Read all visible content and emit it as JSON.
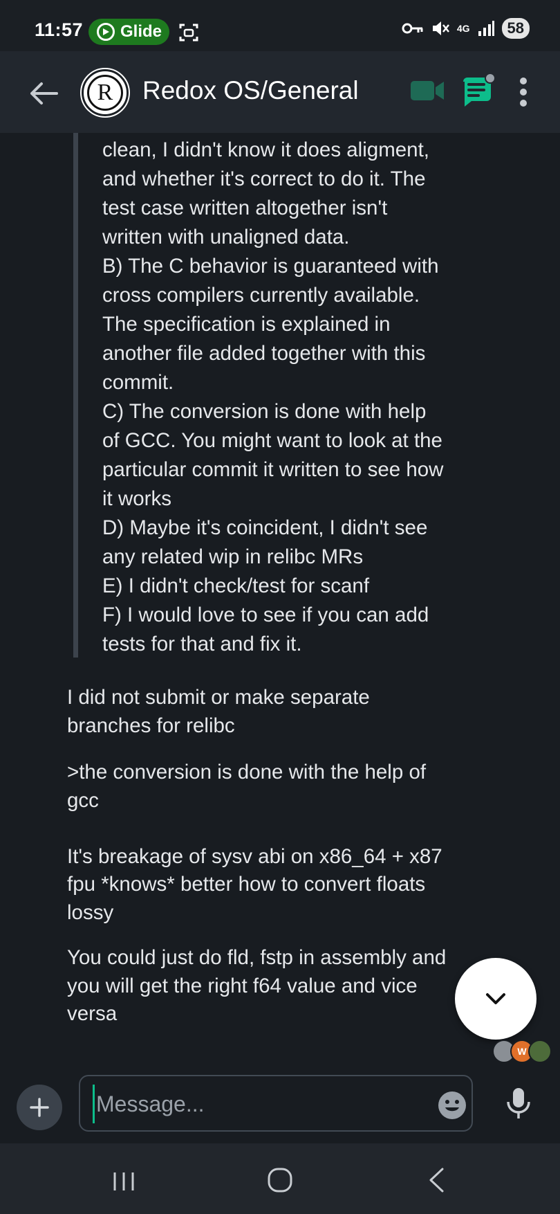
{
  "status_bar": {
    "time": "11:57",
    "app_pill": "Glide",
    "network": "4G",
    "battery": "58"
  },
  "header": {
    "avatar_letter": "R",
    "title": "Redox OS/General"
  },
  "quoted_message": "clean, I didn't know it does aligment,\nand whether it's correct to do it. The\ntest case written altogether isn't\nwritten with unaligned data.\nB) The C behavior is guaranteed with\ncross compilers currently available.\nThe specification is explained in\nanother file added together with this\ncommit.\nC) The conversion is done with help\nof GCC. You might want to look at the\nparticular commit it written to see how\nit works\nD) Maybe it's coincident, I didn't see\nany related wip in relibc MRs\nE) I didn't check/test for scanf\nF) I would love to see if you can add\ntests for that and fix it.",
  "messages": [
    "I did not submit or make separate\nbranches for relibc",
    ">the conversion is done with the help of\ngcc\n\nIt's breakage of sysv abi on x86_64 + x87\nfpu *knows* better how to convert floats\nlossy",
    "You could just do fld, fstp in assembly and\nyou will get the right f64 value and vice\nversa"
  ],
  "read_receipts": [
    "",
    "W",
    ""
  ],
  "composer": {
    "placeholder": "Message..."
  },
  "colors": {
    "background": "#181c21",
    "header": "#22272e",
    "accent": "#0dbd8b",
    "glide_pill": "#1e7a1f"
  }
}
